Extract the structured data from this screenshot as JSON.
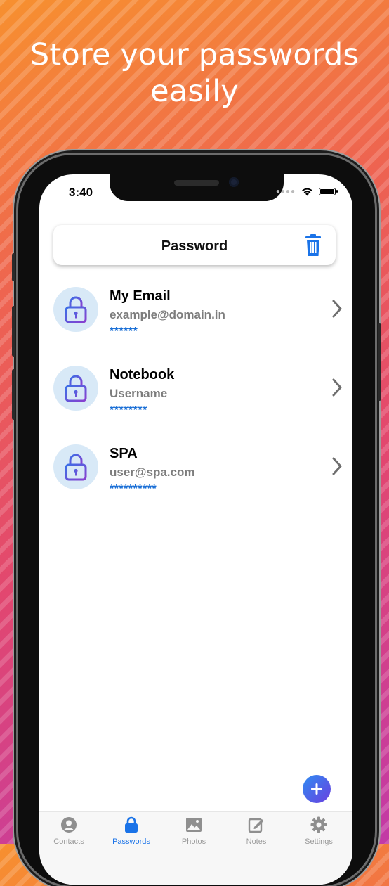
{
  "promo": {
    "headline_line1": "Store your passwords",
    "headline_line2": "easily"
  },
  "status_bar": {
    "time": "3:40"
  },
  "header": {
    "title": "Password",
    "delete_icon": "trash-icon"
  },
  "entries": [
    {
      "title": "My Email",
      "subtitle": "example@domain.in",
      "masked": "******",
      "icon": "lock-icon"
    },
    {
      "title": "Notebook",
      "subtitle": "Username",
      "masked": "********",
      "icon": "lock-icon"
    },
    {
      "title": "SPA",
      "subtitle": "user@spa.com",
      "masked": "**********",
      "icon": "lock-icon"
    }
  ],
  "fab": {
    "icon": "plus-icon"
  },
  "tabs": [
    {
      "label": "Contacts",
      "icon": "contact-icon",
      "active": false
    },
    {
      "label": "Passwords",
      "icon": "lock-icon",
      "active": true
    },
    {
      "label": "Photos",
      "icon": "photo-icon",
      "active": false
    },
    {
      "label": "Notes",
      "icon": "note-icon",
      "active": false
    },
    {
      "label": "Settings",
      "icon": "gear-icon",
      "active": false
    }
  ],
  "colors": {
    "accent": "#1a73e8",
    "avatar_bg": "#d8e9f7",
    "masked_text": "#1a6fd6"
  }
}
